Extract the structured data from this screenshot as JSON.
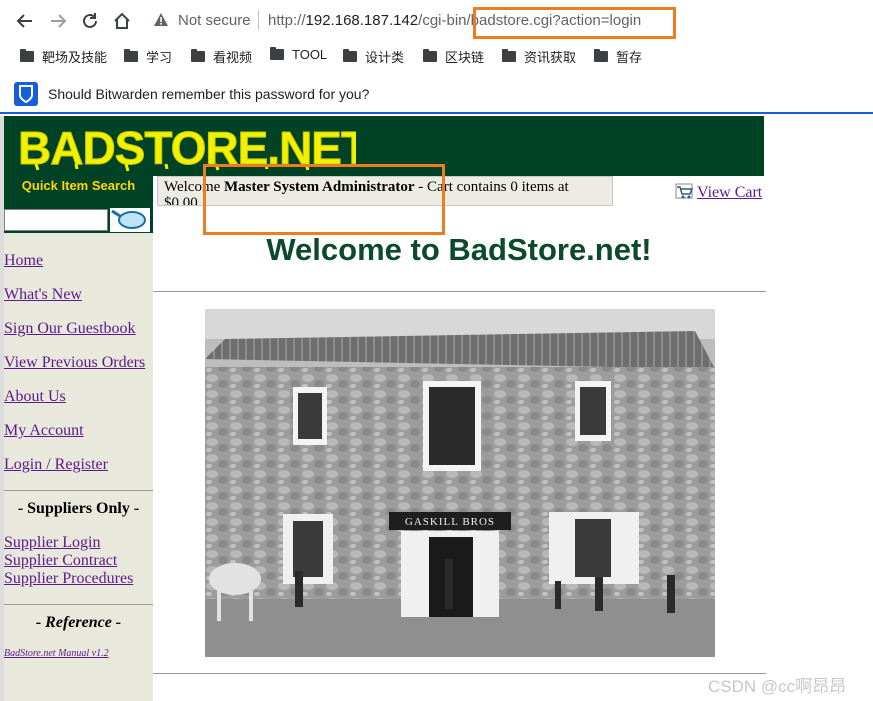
{
  "browser": {
    "security_label": "Not secure",
    "url_prefix": "http://",
    "url_host": "192.168.187.142",
    "url_path": "/cgi-bin/badstore.cgi?action=login"
  },
  "bookmarks": [
    "靶场及技能",
    "学习",
    "看视频",
    "TOOL",
    "设计类",
    "区块链",
    "资讯获取",
    "暂存"
  ],
  "bitwarden": {
    "message": "Should Bitwarden remember this password for you?"
  },
  "site": {
    "logo_text": "BADSTORE.NET",
    "search_label": "Quick Item Search",
    "search_value": "",
    "welcome_prefix": "Welcome ",
    "user_name": "Master System Administrator",
    "welcome_suffix": " - Cart contains 0 items at $0.00",
    "cart_label": "View Cart",
    "main_title": "Welcome to BadStore.net!"
  },
  "sidebar": {
    "links": [
      "Home",
      "What's New",
      "Sign Our Guestbook",
      "View Previous Orders",
      "About Us",
      "My Account",
      "Login / Register"
    ],
    "suppliers_heading": "- Suppliers Only -",
    "supplier_links": [
      "Supplier Login",
      "Supplier Contract",
      "Supplier Procedures"
    ],
    "reference_heading": "- Reference -",
    "manual_link": "BadStore.net Manual v1.2"
  },
  "photo": {
    "sign_text": "GASKILL BROS"
  },
  "watermark": "CSDN @cc啊昂昂",
  "colors": {
    "banner_green": "#004225",
    "highlight_orange": "#ed7d1f",
    "link_purple": "#5a1a8a",
    "title_green": "#0b4a2a"
  }
}
